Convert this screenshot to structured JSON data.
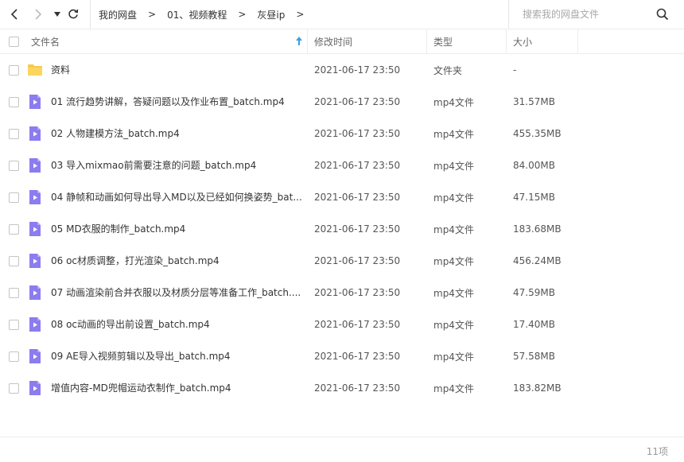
{
  "breadcrumb": [
    "我的网盘",
    "01、视频教程",
    "灰昼ip"
  ],
  "search": {
    "placeholder": "搜索我的网盘文件"
  },
  "columns": {
    "name": "文件名",
    "time": "修改时间",
    "type": "类型",
    "size": "大小"
  },
  "colors": {
    "folder": "#f7c94c",
    "video": "#8b7cf0",
    "sort_arrow": "#3aa0e0"
  },
  "files": [
    {
      "icon": "folder-icon",
      "name": "资料",
      "time": "2021-06-17 23:50",
      "type": "文件夹",
      "size": "-"
    },
    {
      "icon": "video-file-icon",
      "name": "01 流行趋势讲解，答疑问题以及作业布置_batch.mp4",
      "time": "2021-06-17 23:50",
      "type": "mp4文件",
      "size": "31.57MB"
    },
    {
      "icon": "video-file-icon",
      "name": "02 人物建模方法_batch.mp4",
      "time": "2021-06-17 23:50",
      "type": "mp4文件",
      "size": "455.35MB"
    },
    {
      "icon": "video-file-icon",
      "name": "03 导入mixmao前需要注意的问题_batch.mp4",
      "time": "2021-06-17 23:50",
      "type": "mp4文件",
      "size": "84.00MB"
    },
    {
      "icon": "video-file-icon",
      "name": "04 静帧和动画如何导出导入MD以及已经如何换姿势_bat...",
      "time": "2021-06-17 23:50",
      "type": "mp4文件",
      "size": "47.15MB"
    },
    {
      "icon": "video-file-icon",
      "name": "05 MD衣服的制作_batch.mp4",
      "time": "2021-06-17 23:50",
      "type": "mp4文件",
      "size": "183.68MB"
    },
    {
      "icon": "video-file-icon",
      "name": "06 oc材质调整，打光渲染_batch.mp4",
      "time": "2021-06-17 23:50",
      "type": "mp4文件",
      "size": "456.24MB"
    },
    {
      "icon": "video-file-icon",
      "name": "07 动画渲染前合并衣服以及材质分层等准备工作_batch....",
      "time": "2021-06-17 23:50",
      "type": "mp4文件",
      "size": "47.59MB"
    },
    {
      "icon": "video-file-icon",
      "name": "08 oc动画的导出前设置_batch.mp4",
      "time": "2021-06-17 23:50",
      "type": "mp4文件",
      "size": "17.40MB"
    },
    {
      "icon": "video-file-icon",
      "name": "09 AE导入视频剪辑以及导出_batch.mp4",
      "time": "2021-06-17 23:50",
      "type": "mp4文件",
      "size": "57.58MB"
    },
    {
      "icon": "video-file-icon",
      "name": "增值内容-MD兜帽运动衣制作_batch.mp4",
      "time": "2021-06-17 23:50",
      "type": "mp4文件",
      "size": "183.82MB"
    }
  ],
  "footer": {
    "count": "11项"
  }
}
